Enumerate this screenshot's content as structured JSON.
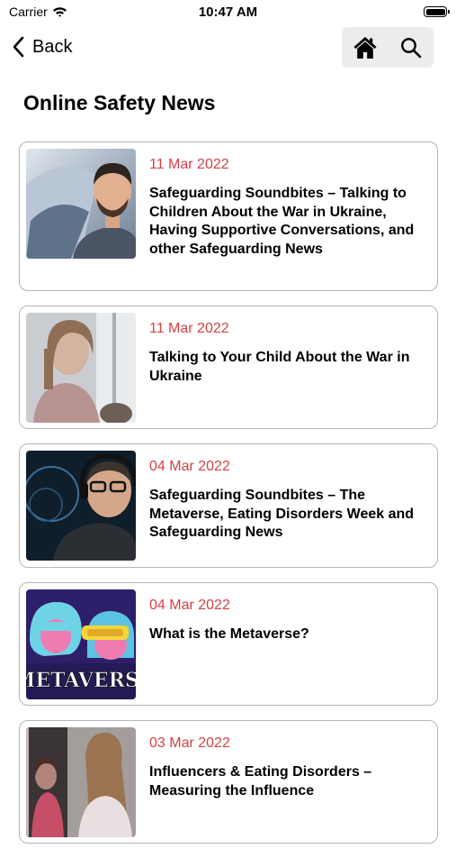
{
  "status_bar": {
    "carrier": "Carrier",
    "time": "10:47 AM"
  },
  "nav": {
    "back_label": "Back",
    "actions": [
      {
        "icon": "home-icon"
      },
      {
        "icon": "search-icon"
      }
    ]
  },
  "page_title": "Online Safety News",
  "colors": {
    "date": "#d64045",
    "card_border": "#b5b5b5",
    "nav_action_bg": "#ececec"
  },
  "articles": [
    {
      "date": "11 Mar 2022",
      "title": "Safeguarding Soundbites – Talking to Children About the War in Ukraine, Having Supportive Conversations, and other Safeguarding News",
      "thumbnail": "man-portrait"
    },
    {
      "date": "11 Mar 2022",
      "title": "Talking to Your Child About the War in Ukraine",
      "thumbnail": "girl-at-window"
    },
    {
      "date": "04 Mar 2022",
      "title": "Safeguarding Soundbites – The Metaverse, Eating Disorders Week and Safeguarding News",
      "thumbnail": "man-with-headphones"
    },
    {
      "date": "04 Mar 2022",
      "title": "What is the Metaverse?",
      "thumbnail": "metaverse-illustration",
      "thumbnail_text": "METAVERSE"
    },
    {
      "date": "03 Mar 2022",
      "title": "Influencers & Eating Disorders – Measuring the Influence",
      "thumbnail": "girls-at-mirror"
    }
  ]
}
